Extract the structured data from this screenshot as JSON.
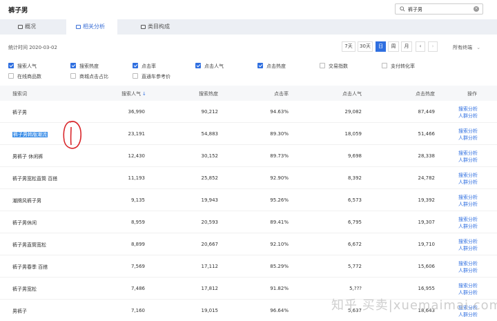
{
  "header": {
    "title": "裤子男"
  },
  "search": {
    "value": "裤子男"
  },
  "tabs": [
    {
      "label": "概况"
    },
    {
      "label": "相关分析"
    },
    {
      "label": "类目构成"
    }
  ],
  "stat": {
    "label": "统计时间 2020-03-02"
  },
  "period": {
    "options": [
      "7天",
      "30天",
      "日",
      "周",
      "月"
    ],
    "prev": "‹",
    "next": "›"
  },
  "category": {
    "label": "所有终端"
  },
  "metrics": [
    {
      "label": "搜索人气",
      "checked": true
    },
    {
      "label": "搜索热度",
      "checked": true
    },
    {
      "label": "点击率",
      "checked": true
    },
    {
      "label": "点击人气",
      "checked": true
    },
    {
      "label": "点击热度",
      "checked": true
    },
    {
      "label": "交易指数",
      "checked": false
    },
    {
      "label": "支付转化率",
      "checked": false
    },
    {
      "label": "在线商品数",
      "checked": false
    },
    {
      "label": "商城点击占比",
      "checked": false
    },
    {
      "label": "直通车参考价",
      "checked": false
    }
  ],
  "table": {
    "headers": [
      "搜索词",
      "搜索人气",
      "搜索热度",
      "点击率",
      "点击人气",
      "点击热度",
      "操作"
    ],
    "actions": [
      "搜索分析",
      "人群分析"
    ],
    "rows": [
      {
        "keyword": "裤子男",
        "search_pop": "36,990",
        "search_heat": "90,212",
        "ctr": "94.63%",
        "click_pop": "29,082",
        "click_heat": "87,449"
      },
      {
        "keyword": "裤子男韩版潮流",
        "search_pop": "23,191",
        "search_heat": "54,883",
        "ctr": "89.30%",
        "click_pop": "18,059",
        "click_heat": "51,466"
      },
      {
        "keyword": "男裤子 休闲裤",
        "search_pop": "12,430",
        "search_heat": "30,152",
        "ctr": "89.73%",
        "click_pop": "9,698",
        "click_heat": "28,338"
      },
      {
        "keyword": "裤子男宽松直筒 百搭",
        "search_pop": "11,193",
        "search_heat": "25,852",
        "ctr": "92.90%",
        "click_pop": "8,392",
        "click_heat": "24,782"
      },
      {
        "keyword": "潮牌风裤子男",
        "search_pop": "9,135",
        "search_heat": "19,943",
        "ctr": "95.26%",
        "click_pop": "6,573",
        "click_heat": "19,392"
      },
      {
        "keyword": "裤子男休闲",
        "search_pop": "8,959",
        "search_heat": "20,593",
        "ctr": "89.41%",
        "click_pop": "6,795",
        "click_heat": "19,307"
      },
      {
        "keyword": "裤子男直筒宽松",
        "search_pop": "8,899",
        "search_heat": "20,667",
        "ctr": "92.10%",
        "click_pop": "6,672",
        "click_heat": "19,710"
      },
      {
        "keyword": "裤子男春季 百搭",
        "search_pop": "7,569",
        "search_heat": "17,112",
        "ctr": "85.29%",
        "click_pop": "5,772",
        "click_heat": "15,606"
      },
      {
        "keyword": "裤子男宽松",
        "search_pop": "7,486",
        "search_heat": "17,812",
        "ctr": "91.82%",
        "click_pop": "5,???",
        "click_heat": "16,955"
      },
      {
        "keyword": "男裤子",
        "search_pop": "7,160",
        "search_heat": "19,015",
        "ctr": "96.64%",
        "click_pop": "5,637",
        "click_heat": "18,643"
      }
    ]
  },
  "watermark": "知乎 买卖|xuemaimai.com",
  "colors": {
    "accent": "#2f6fe0",
    "highlight": "#3d8fe8",
    "annotation": "#d9262b"
  }
}
